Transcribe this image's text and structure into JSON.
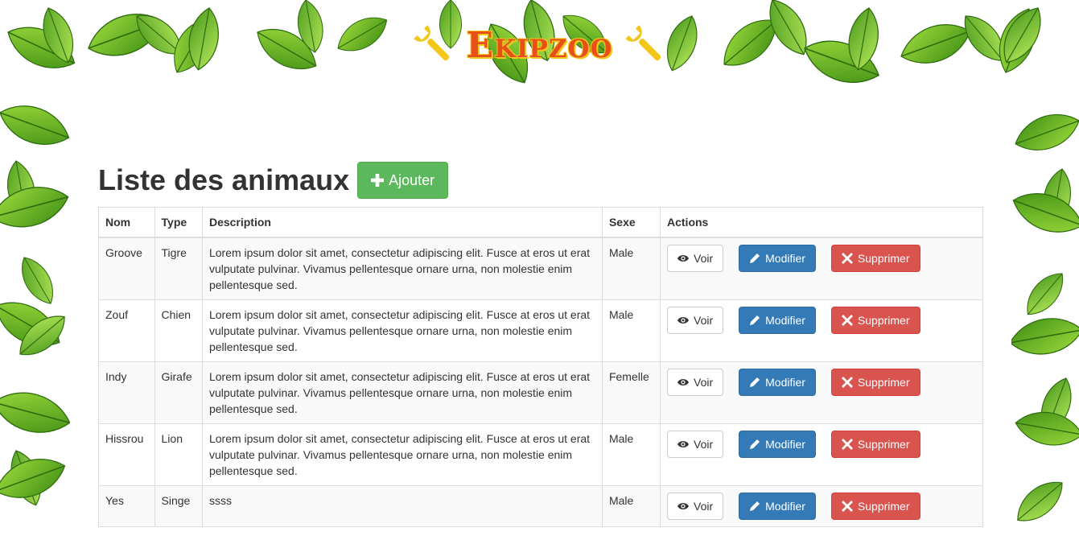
{
  "brand": {
    "title": "Ekipzoo"
  },
  "page": {
    "title": "Liste des animaux",
    "add_label": "Ajouter"
  },
  "table": {
    "headers": [
      "Nom",
      "Type",
      "Description",
      "Sexe",
      "Actions"
    ],
    "rows": [
      {
        "nom": "Groove",
        "type": "Tigre",
        "description": "Lorem ipsum dolor sit amet, consectetur adipiscing elit. Fusce at eros ut erat vulputate pulvinar. Vivamus pellentesque ornare urna, non molestie enim pellentesque sed.",
        "sexe": "Male"
      },
      {
        "nom": "Zouf",
        "type": "Chien",
        "description": "Lorem ipsum dolor sit amet, consectetur adipiscing elit. Fusce at eros ut erat vulputate pulvinar. Vivamus pellentesque ornare urna, non molestie enim pellentesque sed.",
        "sexe": "Male"
      },
      {
        "nom": "Indy",
        "type": "Girafe",
        "description": "Lorem ipsum dolor sit amet, consectetur adipiscing elit. Fusce at eros ut erat vulputate pulvinar. Vivamus pellentesque ornare urna, non molestie enim pellentesque sed.",
        "sexe": "Femelle"
      },
      {
        "nom": "Hissrou",
        "type": "Lion",
        "description": "Lorem ipsum dolor sit amet, consectetur adipiscing elit. Fusce at eros ut erat vulputate pulvinar. Vivamus pellentesque ornare urna, non molestie enim pellentesque sed.",
        "sexe": "Male"
      },
      {
        "nom": "Yes",
        "type": "Singe",
        "description": "ssss",
        "sexe": "Male"
      }
    ]
  },
  "actions": {
    "view": "Voir",
    "edit": "Modifier",
    "delete": "Supprimer"
  },
  "colors": {
    "brand": "#e8501a",
    "brand_outline": "#f3c61a",
    "success": "#5cb85c",
    "primary": "#337ab7",
    "danger": "#d9534f",
    "leaf": "#6cbf2a"
  },
  "icons": {
    "brand_left": "wrench-icon",
    "brand_right": "wrench-icon",
    "add": "plus-icon",
    "view": "eye-icon",
    "edit": "pencil-icon",
    "delete": "x-icon"
  }
}
